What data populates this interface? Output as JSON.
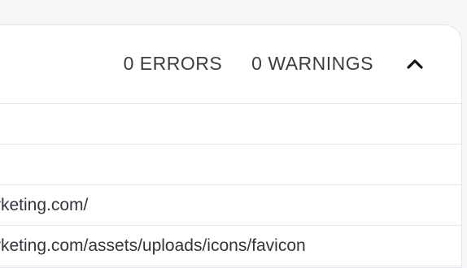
{
  "summary": {
    "errors_label": "0 ERRORS",
    "warnings_label": "0 WARNINGS"
  },
  "collapse_icon": "chevron-up-icon",
  "rows": [
    {
      "text": ""
    },
    {
      "text": ""
    },
    {
      "text": "rketing.com/"
    },
    {
      "text": "rketing.com/assets/uploads/icons/favicon"
    }
  ]
}
